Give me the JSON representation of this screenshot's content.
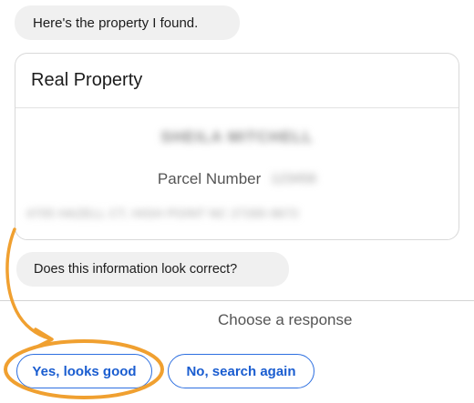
{
  "messages": {
    "intro": "Here's the property I found.",
    "question": "Does this information look correct?"
  },
  "card": {
    "title": "Real Property",
    "owner_name": "SHEILA MITCHELL",
    "parcel_label": "Parcel Number",
    "parcel_value": "123456",
    "address": "4705 HAZELL CT, HIGH POINT NC 27265-9672"
  },
  "response": {
    "prompt": "Choose a response",
    "options": [
      "Yes, looks good",
      "No, search again"
    ]
  },
  "colors": {
    "button_border": "#2d6fe0",
    "button_text": "#1a5dd0",
    "annotation": "#f0a030",
    "bubble_bg": "#f0f0f0"
  },
  "icons": {
    "annotation_arrow": "curved-arrow-icon",
    "annotation_circle": "highlight-ellipse-icon"
  }
}
